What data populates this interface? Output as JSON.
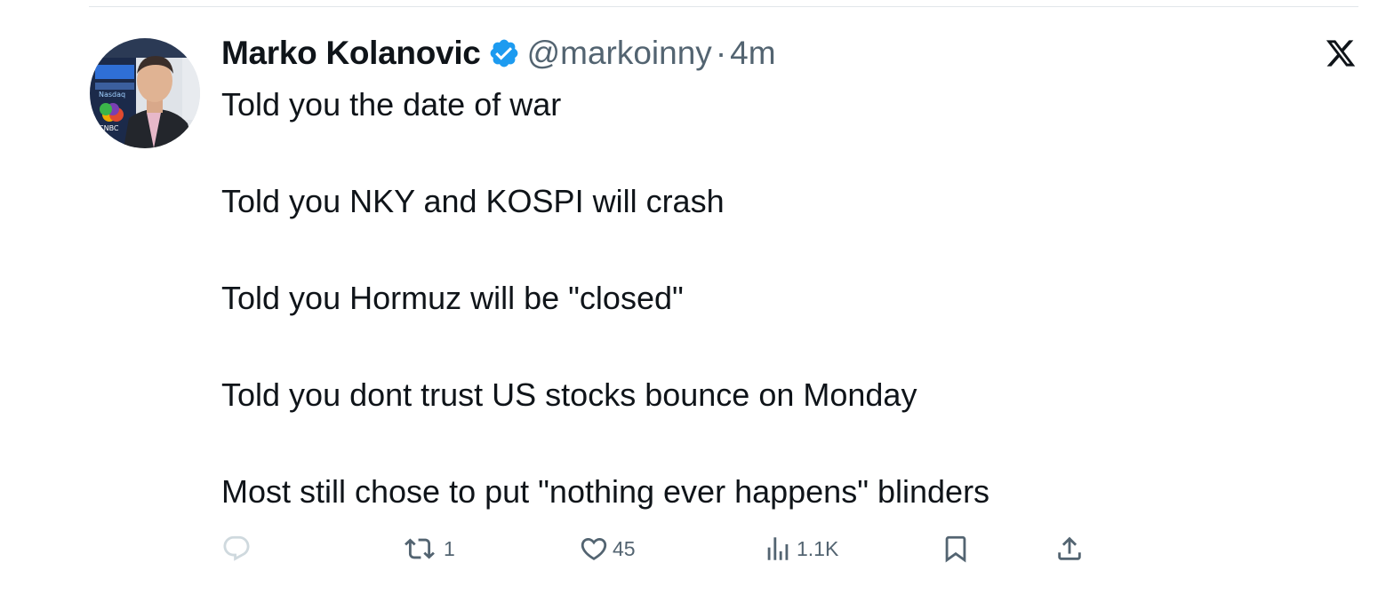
{
  "tweet": {
    "author": {
      "display_name": "Marko Kolanovic",
      "handle": "@markoinny",
      "separator": "·",
      "time": "4m",
      "verified_icon": "verified-badge-icon",
      "avatar_texts": {
        "nasdaq": "Nasdaq",
        "cnbc": "CNBC"
      }
    },
    "platform_icon": "x-logo-icon",
    "lines": [
      "Told you the date of war",
      "Told you NKY and KOSPI will crash",
      "Told you Hormuz will be \"closed\"",
      "Told you dont trust US stocks bounce on Monday",
      "Most still chose to put \"nothing ever happens\" blinders"
    ],
    "actions": {
      "reply": {
        "icon": "reply-icon",
        "count": ""
      },
      "repost": {
        "icon": "repost-icon",
        "count": "1"
      },
      "like": {
        "icon": "heart-icon",
        "count": "45"
      },
      "views": {
        "icon": "views-icon",
        "count": "1.1K"
      },
      "bookmark": {
        "icon": "bookmark-icon"
      },
      "share": {
        "icon": "share-icon"
      }
    }
  },
  "colors": {
    "text_primary": "#0f1419",
    "text_secondary": "#536471",
    "verified_blue": "#1d9bf0",
    "divider": "#e1e6ea",
    "reply_icon_faded": "#cfd9de"
  }
}
